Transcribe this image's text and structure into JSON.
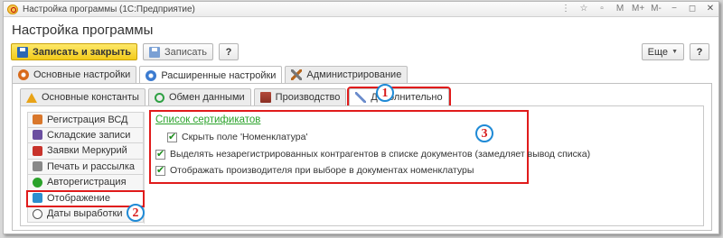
{
  "window": {
    "title": "Настройка программы (1С:Предприятие)"
  },
  "window_controls": [
    "⋮",
    "☆",
    "▫",
    "M",
    "M+",
    "M-",
    "−",
    "◻",
    "✕"
  ],
  "page_title": "Настройка программы",
  "toolbar": {
    "save_close_label": "Записать и закрыть",
    "save_label": "Записать",
    "help_label": "?",
    "more_label": "Еще",
    "help2_label": "?"
  },
  "main_tabs": [
    {
      "label": "Основные настройки"
    },
    {
      "label": "Расширенные настройки"
    },
    {
      "label": "Администрирование"
    }
  ],
  "sub_tabs": [
    {
      "label": "Основные константы"
    },
    {
      "label": "Обмен данными"
    },
    {
      "label": "Производство"
    },
    {
      "label": "Дополнительно"
    }
  ],
  "sidebar": {
    "items": [
      {
        "label": "Регистрация ВСД",
        "icon": "documents-icon",
        "color": "#d9772b"
      },
      {
        "label": "Складские записи",
        "icon": "warehouse-icon",
        "color": "#6b4fa0"
      },
      {
        "label": "Заявки Меркурий",
        "icon": "box-icon",
        "color": "#c8332b"
      },
      {
        "label": "Печать и рассылка",
        "icon": "printer-icon",
        "color": "#888888"
      },
      {
        "label": "Авторегистрация",
        "icon": "check-icon",
        "color": "#2aa22a"
      },
      {
        "label": "Отображение",
        "icon": "monitor-icon",
        "color": "#2c8fcf"
      },
      {
        "label": "Даты выработки",
        "icon": "clock-icon",
        "color": "#555555"
      }
    ]
  },
  "content": {
    "cert_link": "Список сертификатов",
    "options": [
      {
        "label": "Скрыть поле 'Номенклатура'",
        "checked": true
      },
      {
        "label": "Выделять незарегистрированных контрагентов в списке документов (замедляет вывод списка)",
        "checked": true
      },
      {
        "label": "Отображать производителя при выборе в документах номенклатуры",
        "checked": true
      }
    ]
  },
  "annotations": {
    "badge1": "1",
    "badge2": "2",
    "badge3": "3"
  },
  "colors": {
    "accent_yellow": "#f3cb1a",
    "highlight_red": "#e01b1b",
    "badge_blue": "#1f8ad6",
    "link_green": "#2aa22a"
  }
}
